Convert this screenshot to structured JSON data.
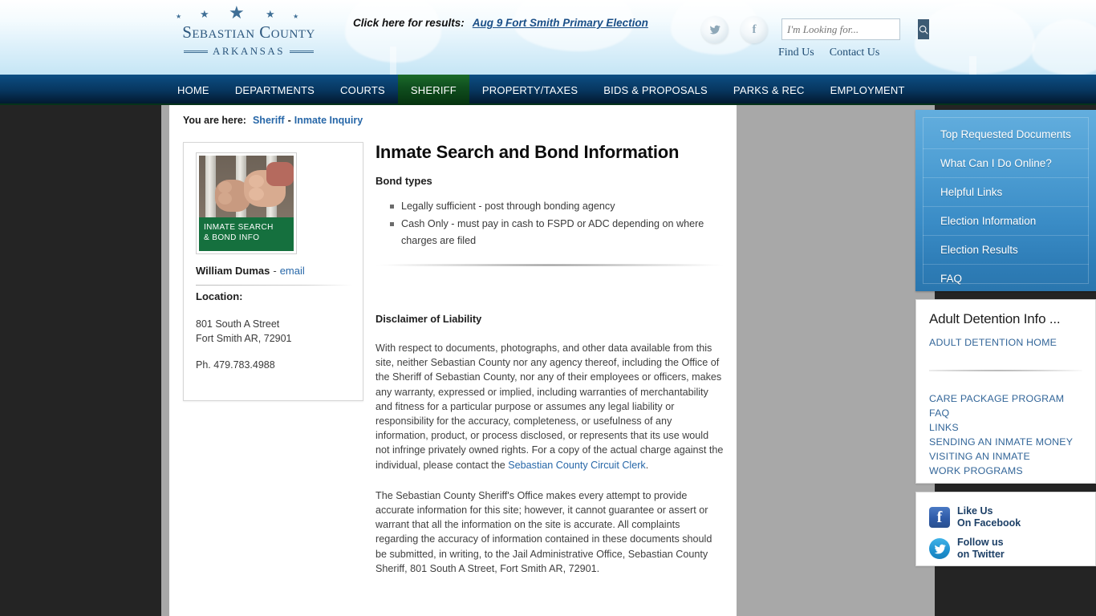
{
  "header": {
    "logo": {
      "line1": "Sebastian County",
      "line2": "ARKANSAS"
    },
    "banner": {
      "prefix": "Click here for results:",
      "link": "Aug 9 Fort Smith Primary Election"
    },
    "search": {
      "placeholder": "I'm Looking for...",
      "value": "",
      "icon": "search-icon"
    },
    "social": [
      {
        "name": "twitter-icon",
        "label": "Twitter"
      },
      {
        "name": "facebook-icon",
        "label": "f"
      }
    ],
    "links": [
      {
        "label": "Find Us"
      },
      {
        "label": "Contact Us"
      }
    ]
  },
  "nav": {
    "items": [
      {
        "label": "HOME",
        "active": false
      },
      {
        "label": "DEPARTMENTS",
        "active": false
      },
      {
        "label": "COURTS",
        "active": false
      },
      {
        "label": "SHERIFF",
        "active": true
      },
      {
        "label": "PROPERTY/TAXES",
        "active": false
      },
      {
        "label": "BIDS & PROPOSALS",
        "active": false
      },
      {
        "label": "PARKS & REC",
        "active": false
      },
      {
        "label": "EMPLOYMENT",
        "active": false
      }
    ],
    "active_color": "#10501f"
  },
  "breadcrumb": {
    "lead": "You are here:",
    "section": "Sheriff",
    "separator": "-",
    "page": "Inmate Inquiry"
  },
  "contact_card": {
    "thumbnail_caption_line1": "INMATE SEARCH",
    "thumbnail_caption_line2": "& BOND INFO",
    "thumbnail_name": "inmate-search-thumbnail",
    "caption_bg": "#15703e",
    "name": "William Dumas",
    "dash": "-",
    "email_label": "email",
    "location_label": "Location:",
    "address_line1": "801 South A Street",
    "address_line2": "Fort Smith AR, 72901",
    "phone": "Ph. 479.783.4988"
  },
  "article": {
    "title": "Inmate Search and Bond Information",
    "bond_types_heading": "Bond types",
    "bond_types": [
      "Legally sufficient - post through bonding agency",
      "Cash Only - must pay in cash to FSPD or ADC depending on where charges are filed"
    ],
    "disclaimer_heading": "Disclaimer of Liability",
    "paragraph1_before_link": "With respect to documents, photographs, and other data available from this site, neither Sebastian County nor any agency thereof, including the Office of the Sheriff of Sebastian County, nor any of their employees or officers, makes any warranty, expressed or implied, including warranties of merchantability and fitness for a particular purpose or assumes any legal liability or responsibility for the accuracy, completeness, or usefulness of any information, product, or process disclosed, or represents that its use would not infringe privately owned rights. For a copy of the actual charge against the individual, please contact the ",
    "paragraph1_link": "Sebastian County Circuit Clerk",
    "paragraph1_after_link": ".",
    "paragraph2": "The Sebastian County Sheriff's Office makes every attempt to provide accurate information for this site; however, it cannot guarantee or assert or warrant that all the information on the site is accurate. All complaints regarding the accuracy of information contained in these documents should be submitted, in writing, to the Jail Administrative Office, Sebastian County Sheriff, 801 South A Street, Fort Smith AR, 72901."
  },
  "sidebar": {
    "quick_links": [
      {
        "label": "Top Requested Documents"
      },
      {
        "label": "What Can I Do Online?"
      },
      {
        "label": "Helpful Links"
      },
      {
        "label": "Election Information"
      },
      {
        "label": "Election Results"
      },
      {
        "label": "FAQ"
      }
    ],
    "detention": {
      "title": "Adult Detention Info ...",
      "home_link": "ADULT DETENTION HOME",
      "links": [
        {
          "label": "CARE PACKAGE PROGRAM"
        },
        {
          "label": "FAQ"
        },
        {
          "label": "LINKS"
        },
        {
          "label": "SENDING AN INMATE MONEY"
        },
        {
          "label": "VISITING AN INMATE"
        },
        {
          "label": "WORK PROGRAMS"
        }
      ]
    },
    "social": {
      "facebook_line1": "Like Us",
      "facebook_line2": "On Facebook",
      "twitter_line1": "Follow us",
      "twitter_line2": "on Twitter"
    }
  }
}
